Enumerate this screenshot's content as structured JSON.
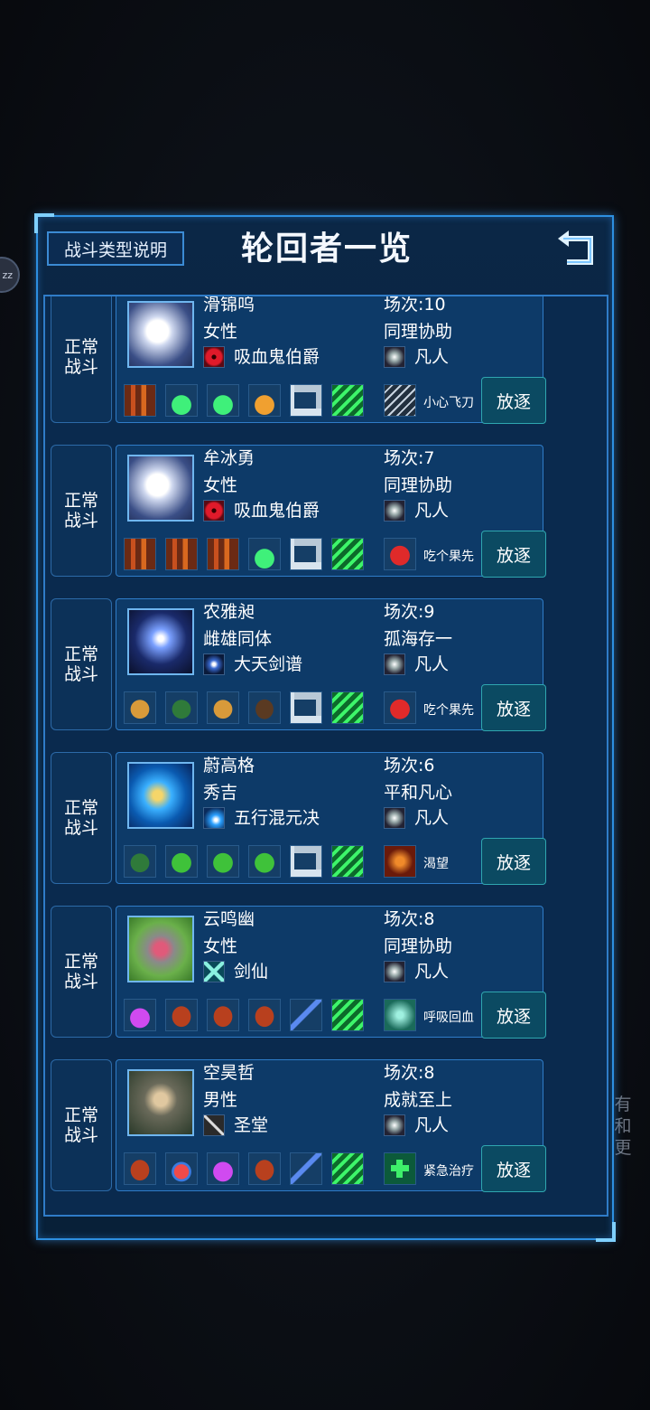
{
  "header": {
    "help_button": "战斗类型说明",
    "title": "轮回者一览",
    "back_icon": "back-arrow-icon"
  },
  "side_badge": "zz",
  "side_text": [
    "有",
    "和",
    "更"
  ],
  "colors": {
    "accent": "#2d8fe0",
    "panel_bg": "#0b2746",
    "card_bg": "#0d3a68"
  },
  "characters": [
    {
      "type_line1": "正常",
      "type_line2": "战斗",
      "name": "滑锦呜",
      "count": "场次:10",
      "gender": "女性",
      "trait": "同理协助",
      "talent": "吸血鬼伯爵",
      "talent_icon": "red-eye-icon",
      "rank": "凡人",
      "portrait": "vampire-girl-portrait",
      "items": [
        "bamboo-icon",
        "green-potion-icon",
        "green-potion-icon",
        "orange-potion-icon",
        "gun-icon",
        "green-coil-icon",
        "claw-icon"
      ],
      "skill": "小心飞刀",
      "action": "放逐"
    },
    {
      "type_line1": "正常",
      "type_line2": "战斗",
      "name": "牟冰勇",
      "count": "场次:7",
      "gender": "女性",
      "trait": "同理协助",
      "talent": "吸血鬼伯爵",
      "talent_icon": "red-eye-icon",
      "rank": "凡人",
      "portrait": "vampire-girl-portrait",
      "items": [
        "bamboo-icon",
        "bamboo-icon",
        "bamboo-icon",
        "green-potion-icon",
        "gun-icon",
        "green-coil-icon",
        "red-fruit-icon"
      ],
      "skill": "吃个果先",
      "action": "放逐"
    },
    {
      "type_line1": "正常",
      "type_line2": "战斗",
      "name": "农雅昶",
      "count": "场次:9",
      "gender": "雌雄同体",
      "trait": "孤海存一",
      "talent": "大天剑谱",
      "talent_icon": "sword-spin-icon",
      "rank": "凡人",
      "portrait": "sword-vortex-portrait",
      "items": [
        "pinecone-icon",
        "green-cone-icon",
        "pinecone-icon",
        "brown-pod-icon",
        "gun-icon",
        "green-coil-icon",
        "red-fruit-icon"
      ],
      "skill": "吃个果先",
      "action": "放逐"
    },
    {
      "type_line1": "正常",
      "type_line2": "战斗",
      "name": "蔚高格",
      "count": "场次:6",
      "gender": "秀吉",
      "trait": "平和凡心",
      "talent": "五行混元决",
      "talent_icon": "blue-wave-icon",
      "rank": "凡人",
      "portrait": "water-swirl-portrait",
      "items": [
        "green-cone-icon",
        "green-leaf-icon",
        "green-leaf-icon",
        "green-leaf-icon",
        "gun-icon",
        "green-coil-icon",
        "flame-beast-icon"
      ],
      "skill": "渴望",
      "action": "放逐"
    },
    {
      "type_line1": "正常",
      "type_line2": "战斗",
      "name": "云鸣幽",
      "count": "场次:8",
      "gender": "女性",
      "trait": "同理协助",
      "talent": "剑仙",
      "talent_icon": "cross-swords-icon",
      "rank": "凡人",
      "portrait": "forest-girl-portrait",
      "items": [
        "purple-potion-icon",
        "meat-icon",
        "meat-icon",
        "meat-icon",
        "blue-dagger-icon",
        "green-coil-icon",
        "breath-heal-icon"
      ],
      "skill": "呼吸回血",
      "action": "放逐"
    },
    {
      "type_line1": "正常",
      "type_line2": "战斗",
      "name": "空昊哲",
      "count": "场次:8",
      "gender": "男性",
      "trait": "成就至上",
      "talent": "圣堂",
      "talent_icon": "pickaxe-icon",
      "rank": "凡人",
      "portrait": "warrior-portrait",
      "items": [
        "meat-icon",
        "red-potion-icon",
        "purple-potion-icon",
        "meat-icon",
        "blue-dagger-icon",
        "green-coil-icon",
        "green-cross-icon"
      ],
      "skill": "紧急治疗",
      "action": "放逐"
    }
  ]
}
